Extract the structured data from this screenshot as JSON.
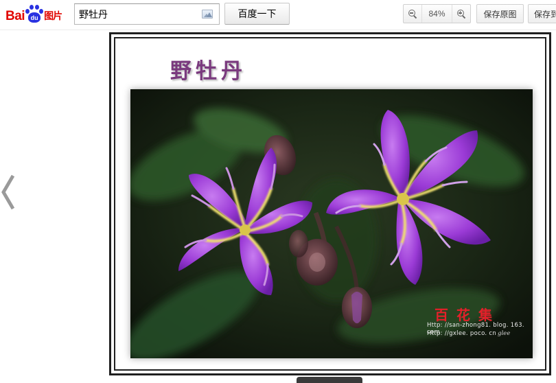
{
  "header": {
    "logo": {
      "bai": "Bai",
      "du": "du",
      "tupian": "图片"
    },
    "search": {
      "value": "野牡丹",
      "placeholder": ""
    },
    "search_button": "百度一下",
    "zoom": {
      "level": "84%"
    },
    "save_original": "保存原图",
    "save_partial": "保存到"
  },
  "viewer": {
    "poster_title": "野牡丹",
    "watermark": {
      "title": "百花集",
      "url1": "Http: //san-zhong81. blog. 163. com",
      "url2": "Http: //gxlee. poco. cn",
      "signature": "glee"
    }
  },
  "colors": {
    "brand_red": "#e10601",
    "brand_blue": "#2932e1",
    "frame": "#1f1f1f",
    "title_purple": "#7a3a7e",
    "watermark_red": "#e4202a"
  },
  "icons": {
    "zoom_out": "zoom-out-icon",
    "zoom_in": "zoom-in-icon",
    "camera": "camera-icon",
    "prev": "chevron-left-icon"
  }
}
